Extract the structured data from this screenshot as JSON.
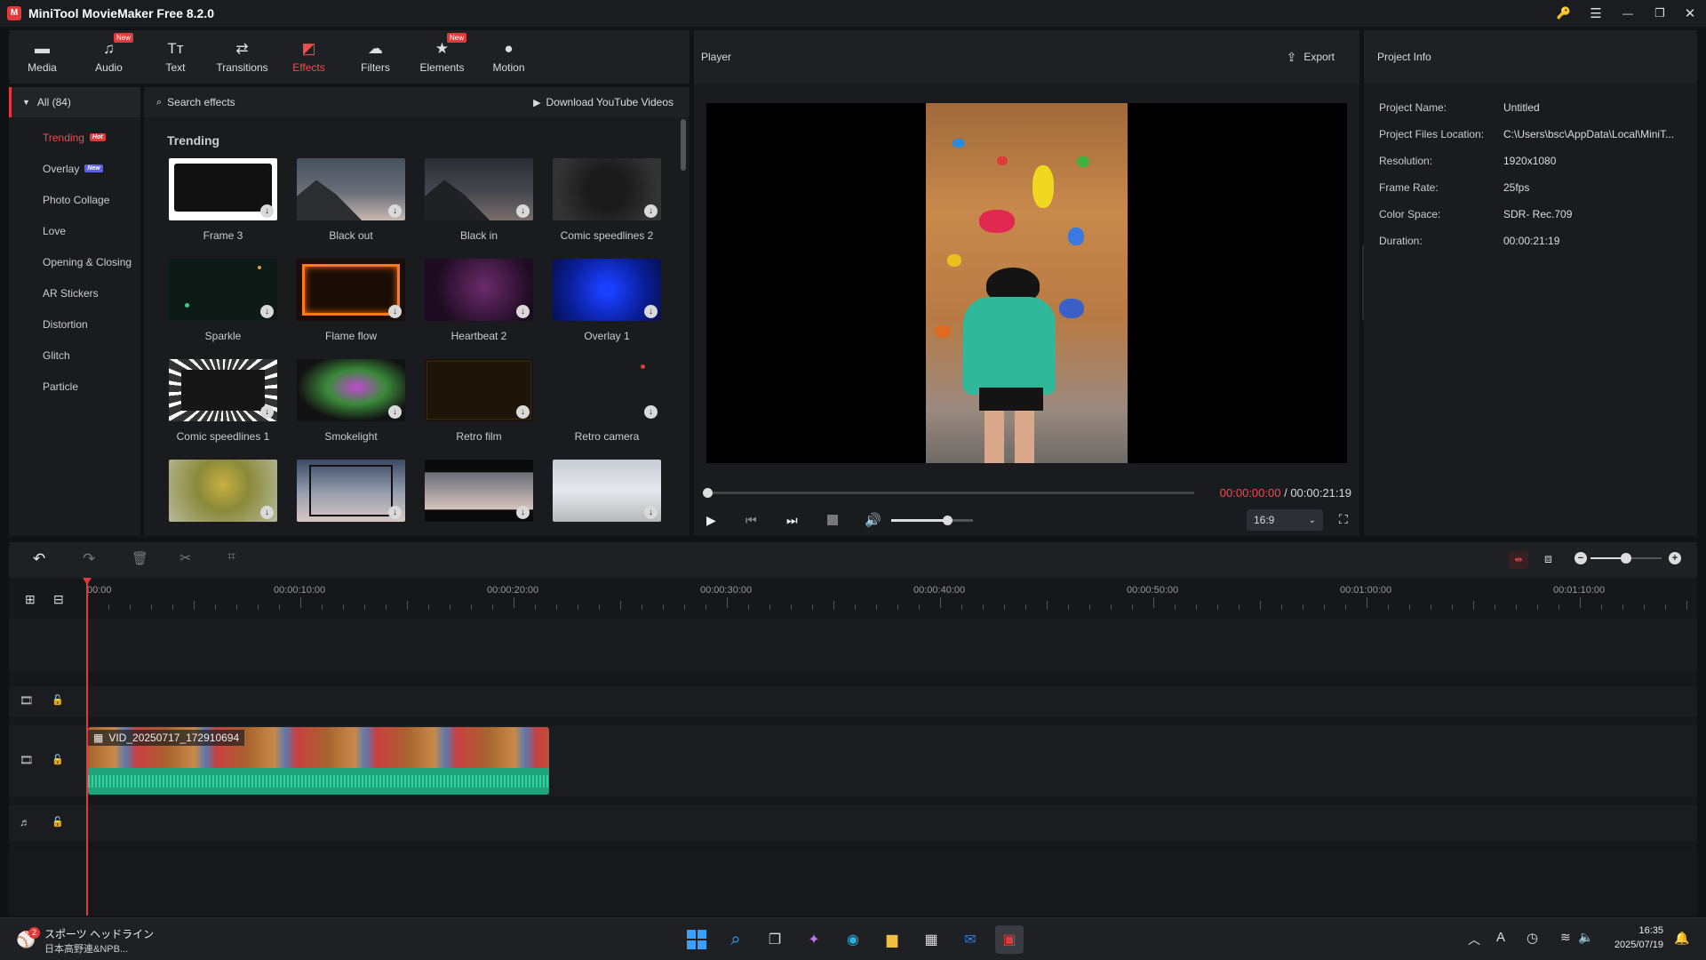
{
  "window": {
    "title": "MiniTool MovieMaker Free 8.2.0",
    "logo_letter": "M",
    "controls": {
      "key": "🔑",
      "menu": "☰",
      "minimize": "—",
      "maximize": "❐",
      "close": "✕"
    }
  },
  "toolbar": {
    "items": [
      {
        "label": "Media",
        "icon": "▬",
        "badge": ""
      },
      {
        "label": "Audio",
        "icon": "♫",
        "badge": "New"
      },
      {
        "label": "Text",
        "icon": "Tт",
        "badge": ""
      },
      {
        "label": "Transitions",
        "icon": "⇄",
        "badge": ""
      },
      {
        "label": "Effects",
        "icon": "◩",
        "badge": ""
      },
      {
        "label": "Filters",
        "icon": "☁",
        "badge": ""
      },
      {
        "label": "Elements",
        "icon": "★",
        "badge": "New"
      },
      {
        "label": "Motion",
        "icon": "●",
        "badge": ""
      }
    ],
    "active": "Effects"
  },
  "categories": {
    "all_label": "All (84)",
    "items": [
      {
        "label": "Trending",
        "tag": "Hot"
      },
      {
        "label": "Overlay",
        "tag": "New"
      },
      {
        "label": "Photo Collage",
        "tag": ""
      },
      {
        "label": "Love",
        "tag": ""
      },
      {
        "label": "Opening & Closing",
        "tag": ""
      },
      {
        "label": "AR Stickers",
        "tag": ""
      },
      {
        "label": "Distortion",
        "tag": ""
      },
      {
        "label": "Glitch",
        "tag": ""
      },
      {
        "label": "Particle",
        "tag": ""
      }
    ]
  },
  "effects": {
    "search_placeholder": "Search effects",
    "download_label": "Download YouTube Videos",
    "section": "Trending",
    "items": [
      {
        "label": "Frame 3"
      },
      {
        "label": "Black out"
      },
      {
        "label": "Black in"
      },
      {
        "label": "Comic speedlines 2"
      },
      {
        "label": "Sparkle"
      },
      {
        "label": "Flame flow"
      },
      {
        "label": "Heartbeat 2"
      },
      {
        "label": "Overlay 1"
      },
      {
        "label": "Comic speedlines 1"
      },
      {
        "label": "Smokelight"
      },
      {
        "label": "Retro film"
      },
      {
        "label": "Retro camera"
      },
      {
        "label": ""
      },
      {
        "label": ""
      },
      {
        "label": ""
      },
      {
        "label": ""
      }
    ]
  },
  "player": {
    "title": "Player",
    "export_label": "Export",
    "current_time": "00:00:00:00",
    "separator": " / ",
    "total_time": "00:00:21:19",
    "aspect": "16:9",
    "volume_level": 0.68,
    "progress": 0
  },
  "project_info": {
    "title": "Project Info",
    "rows": [
      {
        "label": "Project Name:",
        "value": "Untitled"
      },
      {
        "label": "Project Files Location:",
        "value": "C:\\Users\\bsc\\AppData\\Local\\MiniT..."
      },
      {
        "label": "Resolution:",
        "value": "1920x1080"
      },
      {
        "label": "Frame Rate:",
        "value": "25fps"
      },
      {
        "label": "Color Space:",
        "value": "SDR- Rec.709"
      },
      {
        "label": "Duration:",
        "value": "00:00:21:19"
      }
    ]
  },
  "timeline": {
    "ruler": [
      "00:00",
      "00:00:10:00",
      "00:00:20:00",
      "00:00:30:00",
      "00:00:40:00",
      "00:00:50:00",
      "00:01:00:00",
      "00:01:10:00"
    ],
    "clip_name": "VID_20250717_172910694",
    "zoom_level": 0.5
  },
  "taskbar": {
    "news_badge": "2",
    "news_title": "スポーツ ヘッドライン",
    "news_sub": "日本高野連&NPB...",
    "time": "16:35",
    "date": "2025/07/19",
    "ime": "A"
  }
}
